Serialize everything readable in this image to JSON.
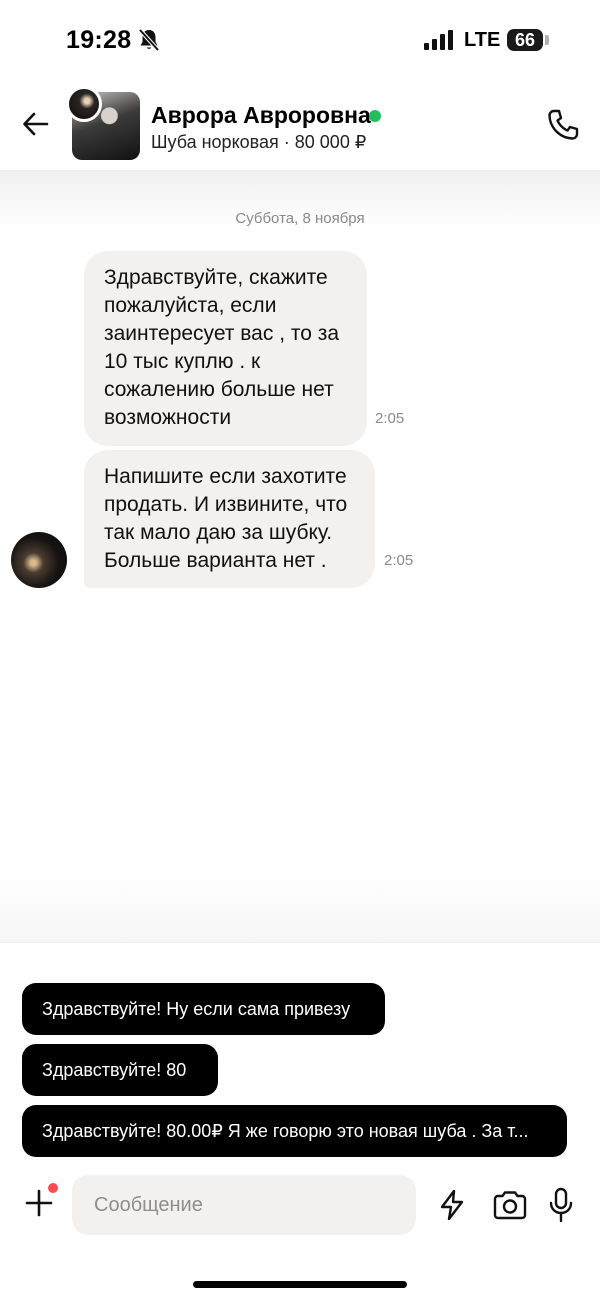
{
  "status_bar": {
    "time": "19:28",
    "network": "LTE",
    "battery": "66"
  },
  "header": {
    "contact_name": "Аврора Авроровна",
    "listing": "Шуба норковая · 80 000 ₽",
    "online_color": "#1fbf5b"
  },
  "chat": {
    "date": "Суббота, 8 ноября",
    "messages": [
      {
        "text": "Здравствуйте, скажите пожалуйста, если заинтересует вас , то за 10 тыс куплю . к сожалению больше нет возможности",
        "time": "2:05"
      },
      {
        "text": "Напишите если захотите продать. И извините, что так мало даю за шубку. Больше варианта нет .",
        "time": "2:05"
      }
    ]
  },
  "quick_replies": [
    "Здравствуйте! Ну если сама привезу",
    "Здравствуйте! 80",
    "Здравствуйте! 80.00₽ Я же говорю это новая шуба . За т..."
  ],
  "composer": {
    "placeholder": "Сообщение"
  },
  "icons": {
    "status": [
      "bell-off-icon",
      "signal-icon",
      "battery-icon"
    ],
    "header": [
      "back-arrow-icon",
      "phone-icon"
    ],
    "composer": [
      "plus-icon",
      "lightning-icon",
      "camera-icon",
      "microphone-icon"
    ]
  }
}
